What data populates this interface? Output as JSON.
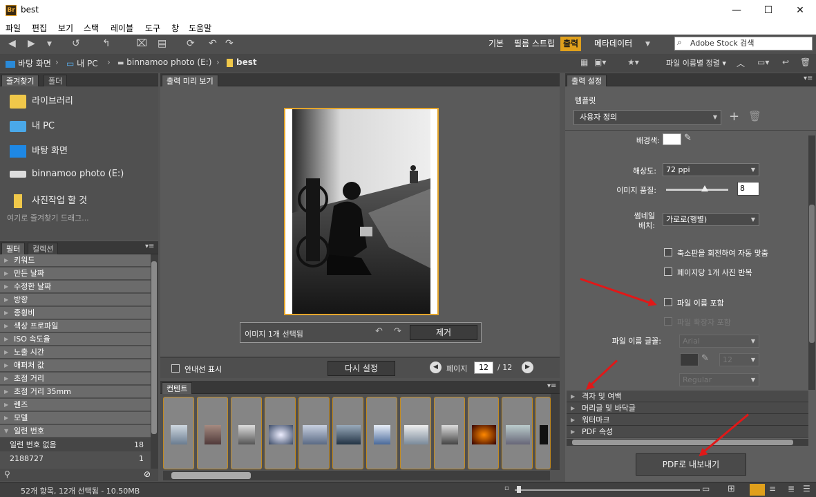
{
  "window": {
    "title": "best",
    "app_icon": "Br",
    "minimize": "—",
    "maximize": "☐",
    "close": "✕"
  },
  "menu": [
    "파일",
    "편집",
    "보기",
    "스택",
    "레이블",
    "도구",
    "창",
    "도움말"
  ],
  "workspaces": {
    "basic": "기본",
    "filmstrip": "필름 스트립",
    "output": "출력",
    "metadata": "메타데이터"
  },
  "search": {
    "placeholder": "Adobe Stock 검색"
  },
  "breadcrumb": {
    "desktop": "바탕 화면",
    "pc": "내 PC",
    "drive": "binnamoo photo (E:)",
    "folder": "best"
  },
  "sort": {
    "label": "파일 이름별 정렬"
  },
  "favorites": {
    "tab_favorites": "즐겨찾기",
    "tab_folders": "폴더",
    "items": [
      "라이브러리",
      "내 PC",
      "바탕 화면",
      "binnamoo photo (E:)",
      "사진작업 할 것"
    ],
    "hint": "여기로 즐겨찾기 드래그..."
  },
  "filter": {
    "tab_filter": "필터",
    "tab_collections": "컬렉션",
    "rows": [
      "키워드",
      "만든 날짜",
      "수정한 날짜",
      "방향",
      "종횡비",
      "색상 프로파일",
      "ISO 속도율",
      "노출 시간",
      "애퍼처 값",
      "초점 거리",
      "초점 거리 35mm",
      "렌즈",
      "모델",
      "일련 번호"
    ],
    "serial_items": [
      {
        "label": "일련 번호 없음",
        "count": "18"
      },
      {
        "label": "2188727",
        "count": "1"
      }
    ]
  },
  "preview": {
    "tab": "출력 미리 보기",
    "selection_text": "이미지 1개 선택됨",
    "remove_label": "제거",
    "guides_label": "안내선 표시",
    "reset_label": "다시 설정",
    "page_label": "페이지",
    "page_current": "12",
    "page_total": "/ 12"
  },
  "content": {
    "tab": "컨텐트"
  },
  "output": {
    "tab": "출력 설정",
    "template_label": "템플릿",
    "template_value": "사용자 정의",
    "bg_label": "배경색:",
    "resolution_label": "해상도:",
    "resolution_value": "72 ppi",
    "quality_label": "이미지 품질:",
    "quality_value": "8",
    "thumb_layout_label": "썸네일\n배치:",
    "thumb_layout_value": "가로로(행별)",
    "chk_rotate": "축소판을 회전하여 자동 맞춤",
    "chk_repeat": "페이지당 1개 사진 반복",
    "chk_filename": "파일 이름 포함",
    "chk_extension": "파일 확장자 포함",
    "font_label": "파일 이름 글꼴:",
    "font_value": "Arial",
    "font_size": "12",
    "font_style": "Regular",
    "sections": [
      "격자 및 여백",
      "머리글 및 바닥글",
      "워터마크",
      "PDF 속성"
    ],
    "export_label": "PDF로 내보내기"
  },
  "status": {
    "text": "52개 항목, 12개 선택됨 - 10.50MB"
  },
  "colors": {
    "accent": "#e0a01c",
    "arrow": "#e01818",
    "panel": "#5e5e5e"
  }
}
